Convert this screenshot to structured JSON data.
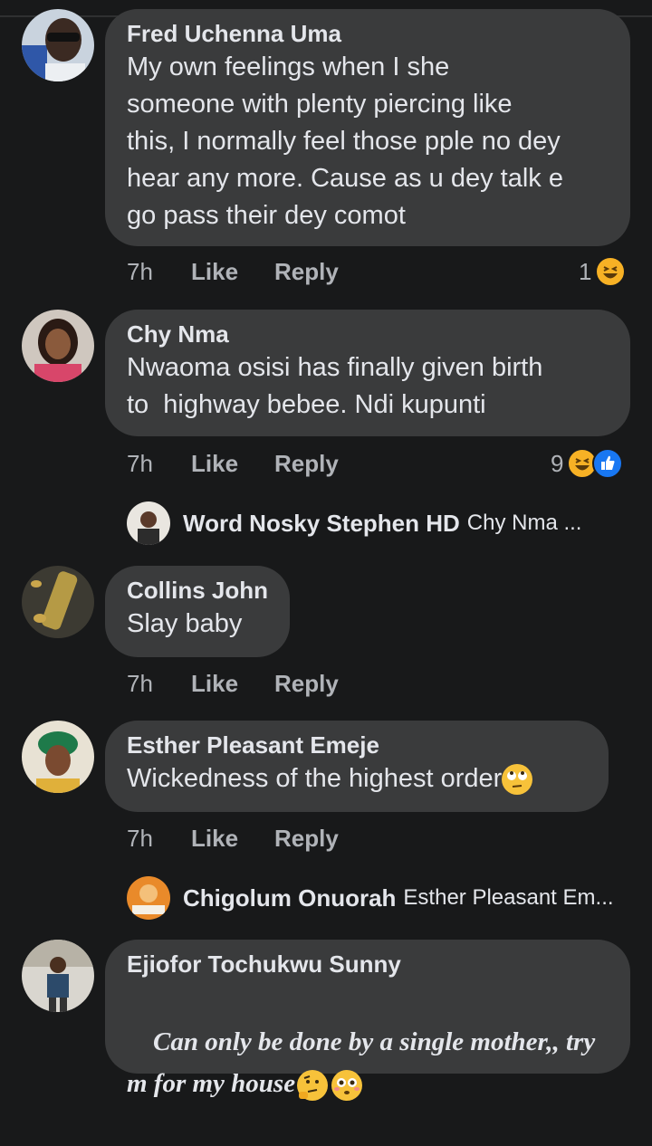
{
  "comments": [
    {
      "name": "Fred Uchenna Uma",
      "text": "My own feelings when I she\nsomeone with plenty piercing like\nthis, I normally feel those pple no dey\nhear any more. Cause as u dey talk e\ngo pass their dey comot",
      "time": "7h",
      "like": "Like",
      "reply": "Reply",
      "reaction_count": "1",
      "reactions": [
        "laugh-emoji"
      ]
    },
    {
      "name": "Chy Nma",
      "text": "Nwaoma osisi has finally given birth\nto  highway bebee. Ndi kupunti",
      "time": "7h",
      "like": "Like",
      "reply": "Reply",
      "reaction_count": "9",
      "reactions": [
        "laugh-emoji",
        "like-emoji"
      ],
      "reply_preview": {
        "name": "Word Nosky Stephen HD",
        "text": "Chy Nma ..."
      }
    },
    {
      "name": "Collins John",
      "text": "Slay baby",
      "time": "7h",
      "like": "Like",
      "reply": "Reply"
    },
    {
      "name": "Esther Pleasant Emeje",
      "text": "Wickedness of the highest order",
      "time": "7h",
      "like": "Like",
      "reply": "Reply",
      "reply_preview": {
        "name": "Chigolum Onuorah",
        "text": "Esther Pleasant Em..."
      }
    },
    {
      "name": "Ejiofor Tochukwu Sunny",
      "text": "Can only be done by a single mother,, try\nm for my house",
      "time": "",
      "like": "",
      "reply": ""
    }
  ],
  "colors": {
    "background": "#18191a",
    "bubble": "#3a3b3c",
    "text": "#e4e6eb",
    "secondary": "#b0b3b8",
    "like_blue": "#1877f2",
    "emoji_yellow": "#f7b125"
  }
}
